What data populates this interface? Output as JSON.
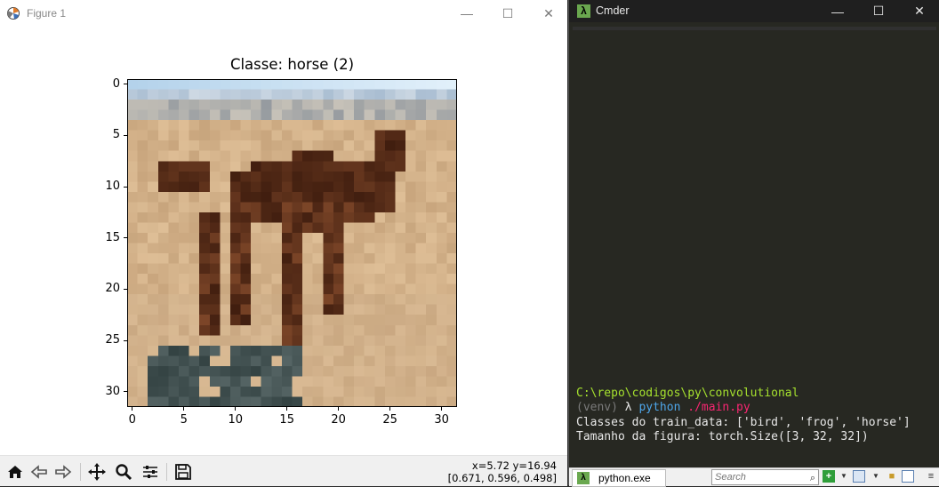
{
  "figure_window": {
    "title": "Figure 1",
    "controls": {
      "minimize": "—",
      "maximize": "☐",
      "close": "✕"
    },
    "plot": {
      "title": "Classe: horse (2)",
      "y_ticks": [
        "0",
        "5",
        "10",
        "15",
        "20",
        "25",
        "30"
      ],
      "x_ticks": [
        "0",
        "5",
        "10",
        "15",
        "20",
        "25",
        "30"
      ],
      "image_grid": "32x32 pixelated photo of a horse on sandy ground"
    },
    "toolbar": {
      "buttons": [
        "home-icon",
        "back-arrow-icon",
        "forward-arrow-icon",
        "pan-icon",
        "zoom-icon",
        "configure-subplots-icon",
        "save-icon"
      ],
      "coord_line1": "x=5.72 y=16.94",
      "coord_line2": "[0.671, 0.596, 0.498]"
    }
  },
  "cmder_window": {
    "title": "Cmder",
    "lambda_glyph": "λ",
    "controls": {
      "minimize": "—",
      "maximize": "☐",
      "close": "✕"
    },
    "terminal": {
      "prompt_path": "C:\\repo\\codigos\\py\\convolutional",
      "venv": "(venv)",
      "lambda": "λ",
      "command": "python",
      "argument": "./main.py",
      "output_line1": "Classes do train_data: ['bird', 'frog', 'horse']",
      "output_line2": "Tamanho da figura: torch.Size([3, 32, 32])"
    },
    "statusbar": {
      "task_label": "python.exe",
      "search_placeholder": "Search"
    }
  }
}
